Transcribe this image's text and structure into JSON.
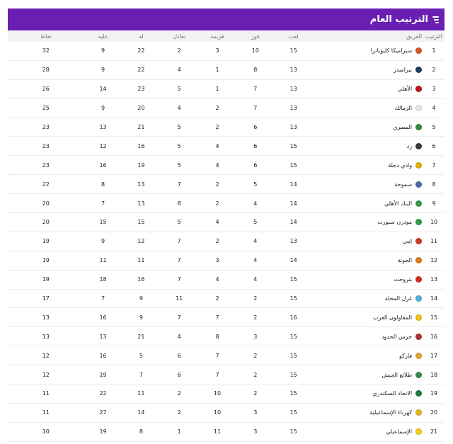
{
  "header": {
    "title": "الترتيب العام"
  },
  "columns": {
    "pos": "الترتيب",
    "team": "الفريق",
    "played": "لعب",
    "won": "فوز",
    "lost": "هزيمة",
    "drawn": "تعادل",
    "for": "له",
    "against": "عليه",
    "points": "نقاط"
  },
  "rows": [
    {
      "pos": "1",
      "team": "سيراميكا كليوباترا",
      "crest": "ceramica-crest-icon",
      "color": "#d9532b",
      "played": "15",
      "won": "10",
      "lost": "3",
      "drawn": "2",
      "for": "22",
      "against": "9",
      "points": "32"
    },
    {
      "pos": "2",
      "team": "بيراميدز",
      "crest": "pyramids-crest-icon",
      "color": "#1e3a6b",
      "played": "13",
      "won": "8",
      "lost": "1",
      "drawn": "4",
      "for": "22",
      "against": "9",
      "points": "28"
    },
    {
      "pos": "3",
      "team": "الأهلي",
      "crest": "ahly-crest-icon",
      "color": "#c0161d",
      "played": "13",
      "won": "7",
      "lost": "1",
      "drawn": "5",
      "for": "23",
      "against": "14",
      "points": "26"
    },
    {
      "pos": "4",
      "team": "الزمالك",
      "crest": "zamalek-crest-icon",
      "color": "#e8e8e8",
      "played": "13",
      "won": "7",
      "lost": "2",
      "drawn": "4",
      "for": "20",
      "against": "9",
      "points": "25"
    },
    {
      "pos": "5",
      "team": "المصري",
      "crest": "masry-crest-icon",
      "color": "#2e8b3a",
      "played": "13",
      "won": "6",
      "lost": "2",
      "drawn": "5",
      "for": "21",
      "against": "13",
      "points": "23"
    },
    {
      "pos": "6",
      "team": "زد",
      "crest": "zed-crest-icon",
      "color": "#3a3a3a",
      "played": "15",
      "won": "6",
      "lost": "4",
      "drawn": "5",
      "for": "16",
      "against": "12",
      "points": "23"
    },
    {
      "pos": "7",
      "team": "وادي دجلة",
      "crest": "wadi-degla-crest-icon",
      "color": "#e0b400",
      "played": "15",
      "won": "6",
      "lost": "4",
      "drawn": "5",
      "for": "19",
      "against": "16",
      "points": "23"
    },
    {
      "pos": "8",
      "team": "سموحة",
      "crest": "smouha-crest-icon",
      "color": "#4a6fa5",
      "played": "14",
      "won": "5",
      "lost": "2",
      "drawn": "7",
      "for": "13",
      "against": "8",
      "points": "22"
    },
    {
      "pos": "9",
      "team": "البنك الأهلي",
      "crest": "national-bank-crest-icon",
      "color": "#3c9a4a",
      "played": "14",
      "won": "4",
      "lost": "2",
      "drawn": "8",
      "for": "13",
      "against": "7",
      "points": "20"
    },
    {
      "pos": "10",
      "team": "مودرن سبورت",
      "crest": "modern-sport-crest-icon",
      "color": "#2f9e44",
      "played": "14",
      "won": "5",
      "lost": "4",
      "drawn": "5",
      "for": "15",
      "against": "15",
      "points": "20"
    },
    {
      "pos": "11",
      "team": "إنبي",
      "crest": "enppi-crest-icon",
      "color": "#cf3a2a",
      "played": "13",
      "won": "4",
      "lost": "2",
      "drawn": "7",
      "for": "12",
      "against": "9",
      "points": "19"
    },
    {
      "pos": "12",
      "team": "الجونة",
      "crest": "gouna-crest-icon",
      "color": "#e07b1a",
      "played": "14",
      "won": "4",
      "lost": "3",
      "drawn": "7",
      "for": "11",
      "against": "11",
      "points": "19"
    },
    {
      "pos": "13",
      "team": "بتروجت",
      "crest": "petrojet-crest-icon",
      "color": "#d62828",
      "played": "15",
      "won": "4",
      "lost": "4",
      "drawn": "7",
      "for": "16",
      "against": "18",
      "points": "19"
    },
    {
      "pos": "14",
      "team": "غزل المحلة",
      "crest": "ghazl-crest-icon",
      "color": "#4fb3d9",
      "played": "15",
      "won": "2",
      "lost": "2",
      "drawn": "11",
      "for": "9",
      "against": "7",
      "points": "17"
    },
    {
      "pos": "15",
      "team": "المقاولون العرب",
      "crest": "arab-contractors-crest-icon",
      "color": "#f0c419",
      "played": "16",
      "won": "2",
      "lost": "7",
      "drawn": "7",
      "for": "9",
      "against": "16",
      "points": "13"
    },
    {
      "pos": "16",
      "team": "حرس الحدود",
      "crest": "haras-crest-icon",
      "color": "#b03030",
      "played": "15",
      "won": "3",
      "lost": "8",
      "drawn": "4",
      "for": "21",
      "against": "13",
      "points": "13"
    },
    {
      "pos": "17",
      "team": "فاركو",
      "crest": "pharco-crest-icon",
      "color": "#e6a72e",
      "played": "15",
      "won": "2",
      "lost": "7",
      "drawn": "6",
      "for": "5",
      "against": "16",
      "points": "12"
    },
    {
      "pos": "18",
      "team": "طلائع الجيش",
      "crest": "talaea-crest-icon",
      "color": "#3b8b4a",
      "played": "15",
      "won": "2",
      "lost": "7",
      "drawn": "6",
      "for": "7",
      "against": "19",
      "points": "12"
    },
    {
      "pos": "19",
      "team": "الاتحاد السكندري",
      "crest": "ittihad-crest-icon",
      "color": "#1f7a3a",
      "played": "15",
      "won": "2",
      "lost": "10",
      "drawn": "2",
      "for": "11",
      "against": "22",
      "points": "11"
    },
    {
      "pos": "20",
      "team": "كهرباء الإسماعيلية",
      "crest": "kahraba-crest-icon",
      "color": "#e8b520",
      "played": "15",
      "won": "3",
      "lost": "10",
      "drawn": "2",
      "for": "14",
      "against": "27",
      "points": "11"
    },
    {
      "pos": "21",
      "team": "الإسماعيلي",
      "crest": "ismaily-crest-icon",
      "color": "#f2d21b",
      "played": "15",
      "won": "3",
      "lost": "11",
      "drawn": "1",
      "for": "8",
      "against": "19",
      "points": "10"
    }
  ]
}
